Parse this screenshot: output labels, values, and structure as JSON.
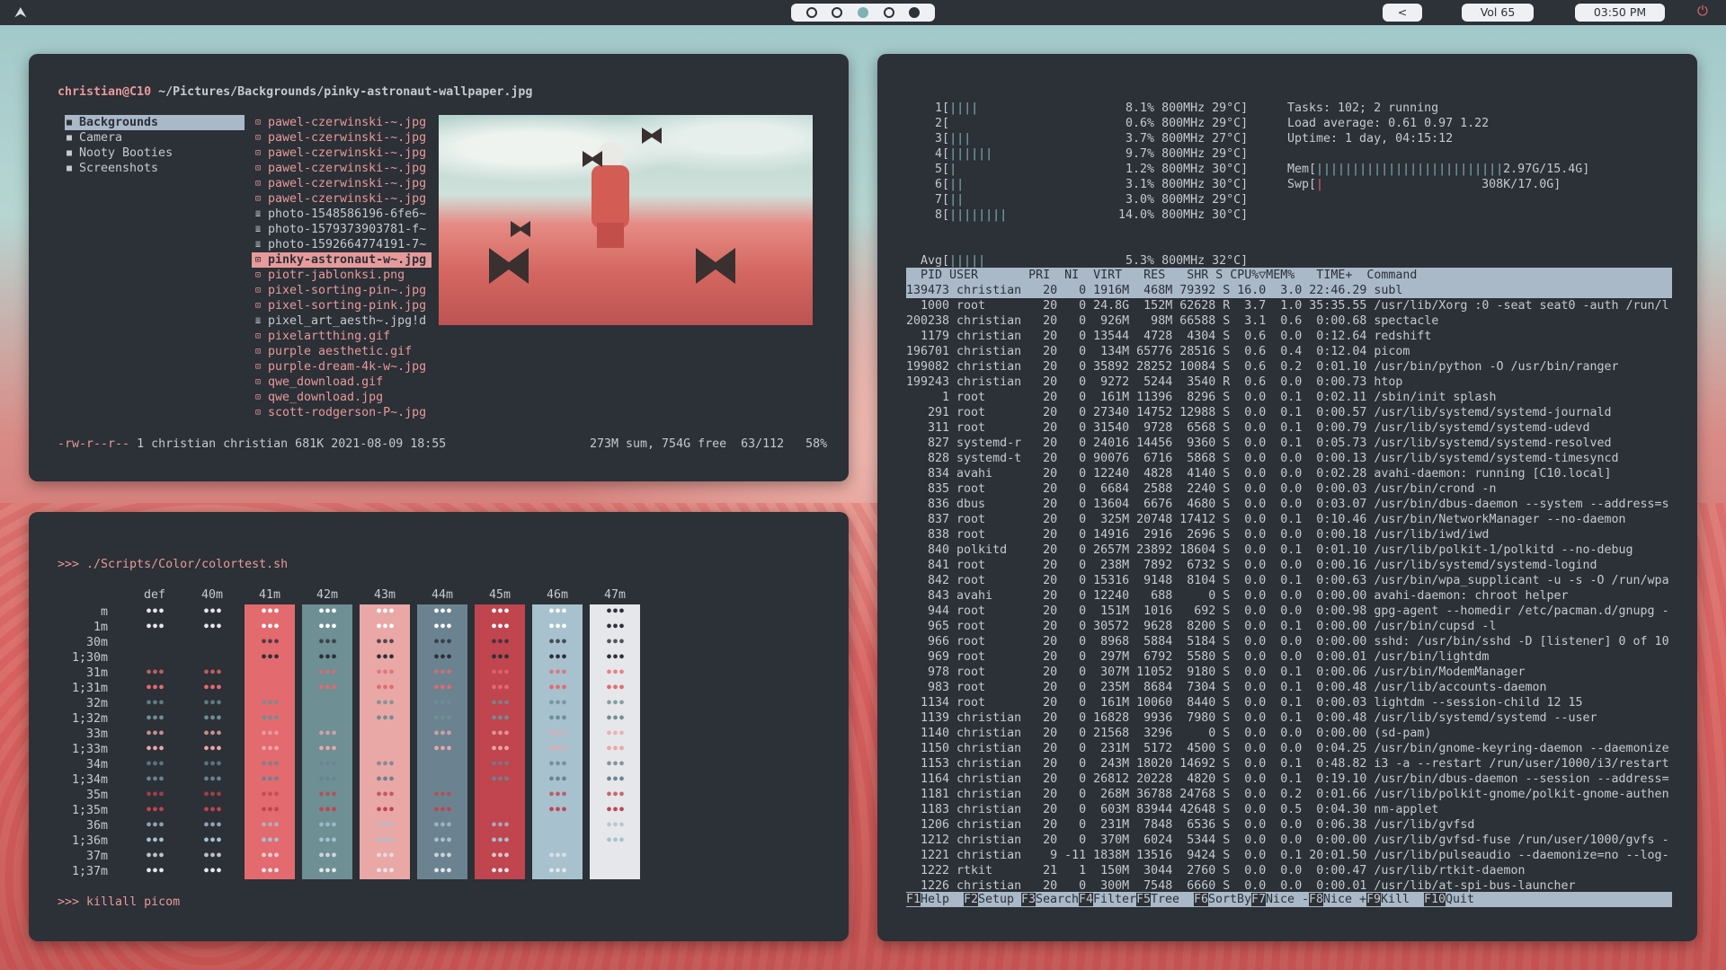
{
  "topbar": {
    "volume": "Vol 65",
    "clock": "03:50 PM",
    "back": "<",
    "workspaces": [
      "empty",
      "empty",
      "active",
      "empty",
      "filled"
    ]
  },
  "ranger": {
    "path_user": "christian@C10",
    "path": "~/Pictures/Backgrounds/pinky-astronaut-wallpaper.jpg",
    "dirs": [
      "Backgrounds",
      "Camera",
      "Nooty Booties",
      "Screenshots"
    ],
    "files": [
      {
        "name": "pawel-czerwinski-~.jpg",
        "type": "img"
      },
      {
        "name": "pawel-czerwinski-~.jpg",
        "type": "img"
      },
      {
        "name": "pawel-czerwinski-~.jpg",
        "type": "img"
      },
      {
        "name": "pawel-czerwinski-~.jpg",
        "type": "img"
      },
      {
        "name": "pawel-czerwinski-~.jpg",
        "type": "img"
      },
      {
        "name": "pawel-czerwinski-~.jpg",
        "type": "img"
      },
      {
        "name": "photo-1548586196-6fe6~",
        "type": "file"
      },
      {
        "name": "photo-1579373903781-f~",
        "type": "file"
      },
      {
        "name": "photo-1592664774191-7~",
        "type": "file"
      },
      {
        "name": "pinky-astronaut-w~.jpg",
        "type": "sel"
      },
      {
        "name": "piotr-jablonksi.png",
        "type": "img"
      },
      {
        "name": "pixel-sorting-pin~.jpg",
        "type": "img"
      },
      {
        "name": "pixel-sorting-pink.jpg",
        "type": "img"
      },
      {
        "name": "pixel_art_aesth~.jpg!d",
        "type": "file"
      },
      {
        "name": "pixelartthing.gif",
        "type": "img"
      },
      {
        "name": "purple aesthetic.gif",
        "type": "img"
      },
      {
        "name": "purple-dream-4k-w~.jpg",
        "type": "img"
      },
      {
        "name": "qwe_download.gif",
        "type": "img"
      },
      {
        "name": "qwe_download.jpg",
        "type": "img"
      },
      {
        "name": "scott-rodgerson-P~.jpg",
        "type": "img"
      }
    ],
    "status_perm": "-rw-r--r--",
    "status_info": " 1 christian christian 681K 2021-08-09 18:55",
    "status_right": "273M sum, 754G free  63/112   58%"
  },
  "colortest": {
    "command": ">>> ./Scripts/Color/colortest.sh",
    "headers": [
      "def",
      "40m",
      "41m",
      "42m",
      "43m",
      "44m",
      "45m",
      "46m",
      "47m"
    ],
    "rows": [
      "m",
      "1m",
      "30m",
      "1;30m",
      "31m",
      "1;31m",
      "32m",
      "1;32m",
      "33m",
      "1;33m",
      "34m",
      "1;34m",
      "35m",
      "1;35m",
      "36m",
      "1;36m",
      "37m",
      "1;37m"
    ],
    "glyph": "•••",
    "bg_colors": [
      "",
      "",
      "#e36a6f",
      "#6e8f94",
      "#e9a7a6",
      "#6b8390",
      "#c0454f",
      "#a7c1cf",
      "#e6e7ea"
    ],
    "fg_colors": [
      "#2c3037",
      "#e36a6f",
      "#6e8f94",
      "#e9a7a6",
      "#6b8390",
      "#c0454f",
      "#a7c1cf",
      "#e6e7ea"
    ],
    "prompt": ">>> ",
    "prompt_cmd": "killall picom"
  },
  "htop": {
    "cpus": [
      {
        "n": "1",
        "bar": "||||",
        "pct": "8.1%",
        "mhz": "800MHz",
        "temp": "29°C"
      },
      {
        "n": "2",
        "bar": "",
        "pct": "0.6%",
        "mhz": "800MHz",
        "temp": "29°C"
      },
      {
        "n": "3",
        "bar": "|||",
        "pct": "3.7%",
        "mhz": "800MHz",
        "temp": "27°C"
      },
      {
        "n": "4",
        "bar": "||||||",
        "pct": "9.7%",
        "mhz": "800MHz",
        "temp": "29°C"
      },
      {
        "n": "5",
        "bar": "|",
        "pct": "1.2%",
        "mhz": "800MHz",
        "temp": "30°C"
      },
      {
        "n": "6",
        "bar": "||",
        "pct": "3.1%",
        "mhz": "800MHz",
        "temp": "30°C"
      },
      {
        "n": "7",
        "bar": "||",
        "pct": "3.0%",
        "mhz": "800MHz",
        "temp": "29°C"
      },
      {
        "n": "8",
        "bar": "||||||||",
        "pct": "14.0%",
        "mhz": "800MHz",
        "temp": "30°C"
      }
    ],
    "avg": {
      "bar": "|||||",
      "pct": "5.3%",
      "mhz": "800MHz",
      "temp": "32°C"
    },
    "tasks": "Tasks: 102; 2 running",
    "load": "Load average: 0.61 0.97 1.22",
    "uptime": "Uptime: 1 day, 04:15:12",
    "mem_bar": "||||||||||||||||||||||||||",
    "mem_val": "2.97G/15.4G",
    "swp_val": "308K/17.0G",
    "header": "  PID USER       PRI  NI  VIRT   RES   SHR S CPU%▽MEM%   TIME+  Command",
    "procs": [
      "139473 christian   20   0 1916M  468M 79392 S 16.0  3.0 22:46.29 subl",
      "  1000 root        20   0 24.8G  152M 62628 R  3.7  1.0 35:35.55 /usr/lib/Xorg :0 -seat seat0 -auth /run/l",
      "200238 christian   20   0  926M   98M 66588 S  3.1  0.6  0:00.68 spectacle",
      "  1179 christian   20   0 13544  4728  4304 S  0.6  0.0  0:12.64 redshift",
      "196701 christian   20   0  134M 65776 28516 S  0.6  0.4  0:12.04 picom",
      "199082 christian   20   0 35892 28252 10084 S  0.6  0.2  0:01.10 /usr/bin/python -O /usr/bin/ranger",
      "199243 christian   20   0  9272  5244  3540 R  0.6  0.0  0:00.73 htop",
      "     1 root        20   0  161M 11396  8296 S  0.0  0.1  0:02.11 /sbin/init splash",
      "   291 root        20   0 27340 14752 12988 S  0.0  0.1  0:00.57 /usr/lib/systemd/systemd-journald",
      "   311 root        20   0 31540  9728  6568 S  0.0  0.1  0:00.79 /usr/lib/systemd/systemd-udevd",
      "   827 systemd-r   20   0 24016 14456  9360 S  0.0  0.1  0:05.73 /usr/lib/systemd/systemd-resolved",
      "   828 systemd-t   20   0 90076  6716  5868 S  0.0  0.0  0:00.13 /usr/lib/systemd/systemd-timesyncd",
      "   834 avahi       20   0 12240  4828  4140 S  0.0  0.0  0:02.28 avahi-daemon: running [C10.local]",
      "   835 root        20   0  6684  2588  2240 S  0.0  0.0  0:00.03 /usr/bin/crond -n",
      "   836 dbus        20   0 13604  6676  4680 S  0.0  0.0  0:03.07 /usr/bin/dbus-daemon --system --address=s",
      "   837 root        20   0  325M 20748 17412 S  0.0  0.1  0:10.46 /usr/bin/NetworkManager --no-daemon",
      "   838 root        20   0 14916  2916  2696 S  0.0  0.0  0:00.18 /usr/lib/iwd/iwd",
      "   840 polkitd     20   0 2657M 23892 18604 S  0.0  0.1  0:01.10 /usr/lib/polkit-1/polkitd --no-debug",
      "   841 root        20   0  238M  7892  6732 S  0.0  0.0  0:00.16 /usr/lib/systemd/systemd-logind",
      "   842 root        20   0 15316  9148  8104 S  0.0  0.1  0:00.63 /usr/bin/wpa_supplicant -u -s -O /run/wpa",
      "   843 avahi       20   0 12240   688     0 S  0.0  0.0  0:00.00 avahi-daemon: chroot helper",
      "   944 root        20   0  151M  1016   692 S  0.0  0.0  0:00.98 gpg-agent --homedir /etc/pacman.d/gnupg -",
      "   965 root        20   0 30572  9628  8200 S  0.0  0.1  0:00.00 /usr/bin/cupsd -l",
      "   966 root        20   0  8968  5884  5184 S  0.0  0.0  0:00.00 sshd: /usr/bin/sshd -D [listener] 0 of 10",
      "   969 root        20   0  297M  6792  5580 S  0.0  0.0  0:00.01 /usr/bin/lightdm",
      "   978 root        20   0  307M 11052  9180 S  0.0  0.1  0:00.06 /usr/bin/ModemManager",
      "   983 root        20   0  235M  8684  7304 S  0.0  0.1  0:00.48 /usr/lib/accounts-daemon",
      "  1134 root        20   0  161M 10060  8440 S  0.0  0.1  0:00.03 lightdm --session-child 12 15",
      "  1139 christian   20   0 16828  9936  7980 S  0.0  0.1  0:00.48 /usr/lib/systemd/systemd --user",
      "  1140 christian   20   0 21568  3296     0 S  0.0  0.0  0:00.00 (sd-pam)",
      "  1150 christian   20   0  231M  5172  4500 S  0.0  0.0  0:04.25 /usr/bin/gnome-keyring-daemon --daemonize",
      "  1153 christian   20   0  243M 18020 14692 S  0.0  0.1  0:48.82 i3 -a --restart /run/user/1000/i3/restart",
      "  1164 christian   20   0 26812 20228  4820 S  0.0  0.1  0:19.10 /usr/bin/dbus-daemon --session --address=",
      "  1181 christian   20   0  268M 36788 24768 S  0.0  0.2  0:01.66 /usr/lib/polkit-gnome/polkit-gnome-authen",
      "  1183 christian   20   0  603M 83944 42648 S  0.0  0.5  0:04.30 nm-applet",
      "  1206 christian   20   0  231M  7848  6536 S  0.0  0.0  0:06.38 /usr/lib/gvfsd",
      "  1212 christian   20   0  370M  6024  5344 S  0.0  0.0  0:00.00 /usr/lib/gvfsd-fuse /run/user/1000/gvfs -",
      "  1221 christian    9 -11 1838M 13516  9424 S  0.0  0.1 20:01.50 /usr/lib/pulseaudio --daemonize=no --log-",
      "  1222 rtkit       21   1  150M  3044  2760 S  0.0  0.0  0:00.47 /usr/lib/rtkit-daemon",
      "  1226 christian   20   0  300M  7548  6660 S  0.0  0.0  0:00.01 /usr/lib/at-spi-bus-launcher"
    ],
    "fkeys": [
      {
        "k": "F1",
        "l": "Help  "
      },
      {
        "k": "F2",
        "l": "Setup "
      },
      {
        "k": "F3",
        "l": "Search"
      },
      {
        "k": "F4",
        "l": "Filter"
      },
      {
        "k": "F5",
        "l": "Tree  "
      },
      {
        "k": "F6",
        "l": "SortBy"
      },
      {
        "k": "F7",
        "l": "Nice -"
      },
      {
        "k": "F8",
        "l": "Nice +"
      },
      {
        "k": "F9",
        "l": "Kill  "
      },
      {
        "k": "F10",
        "l": "Quit"
      }
    ]
  },
  "colors": {
    "accent_pink": "#e79a9a",
    "accent_blue": "#a9b9c8",
    "teal": "#7fb1b5",
    "terminal_bg": "#2c3037"
  }
}
